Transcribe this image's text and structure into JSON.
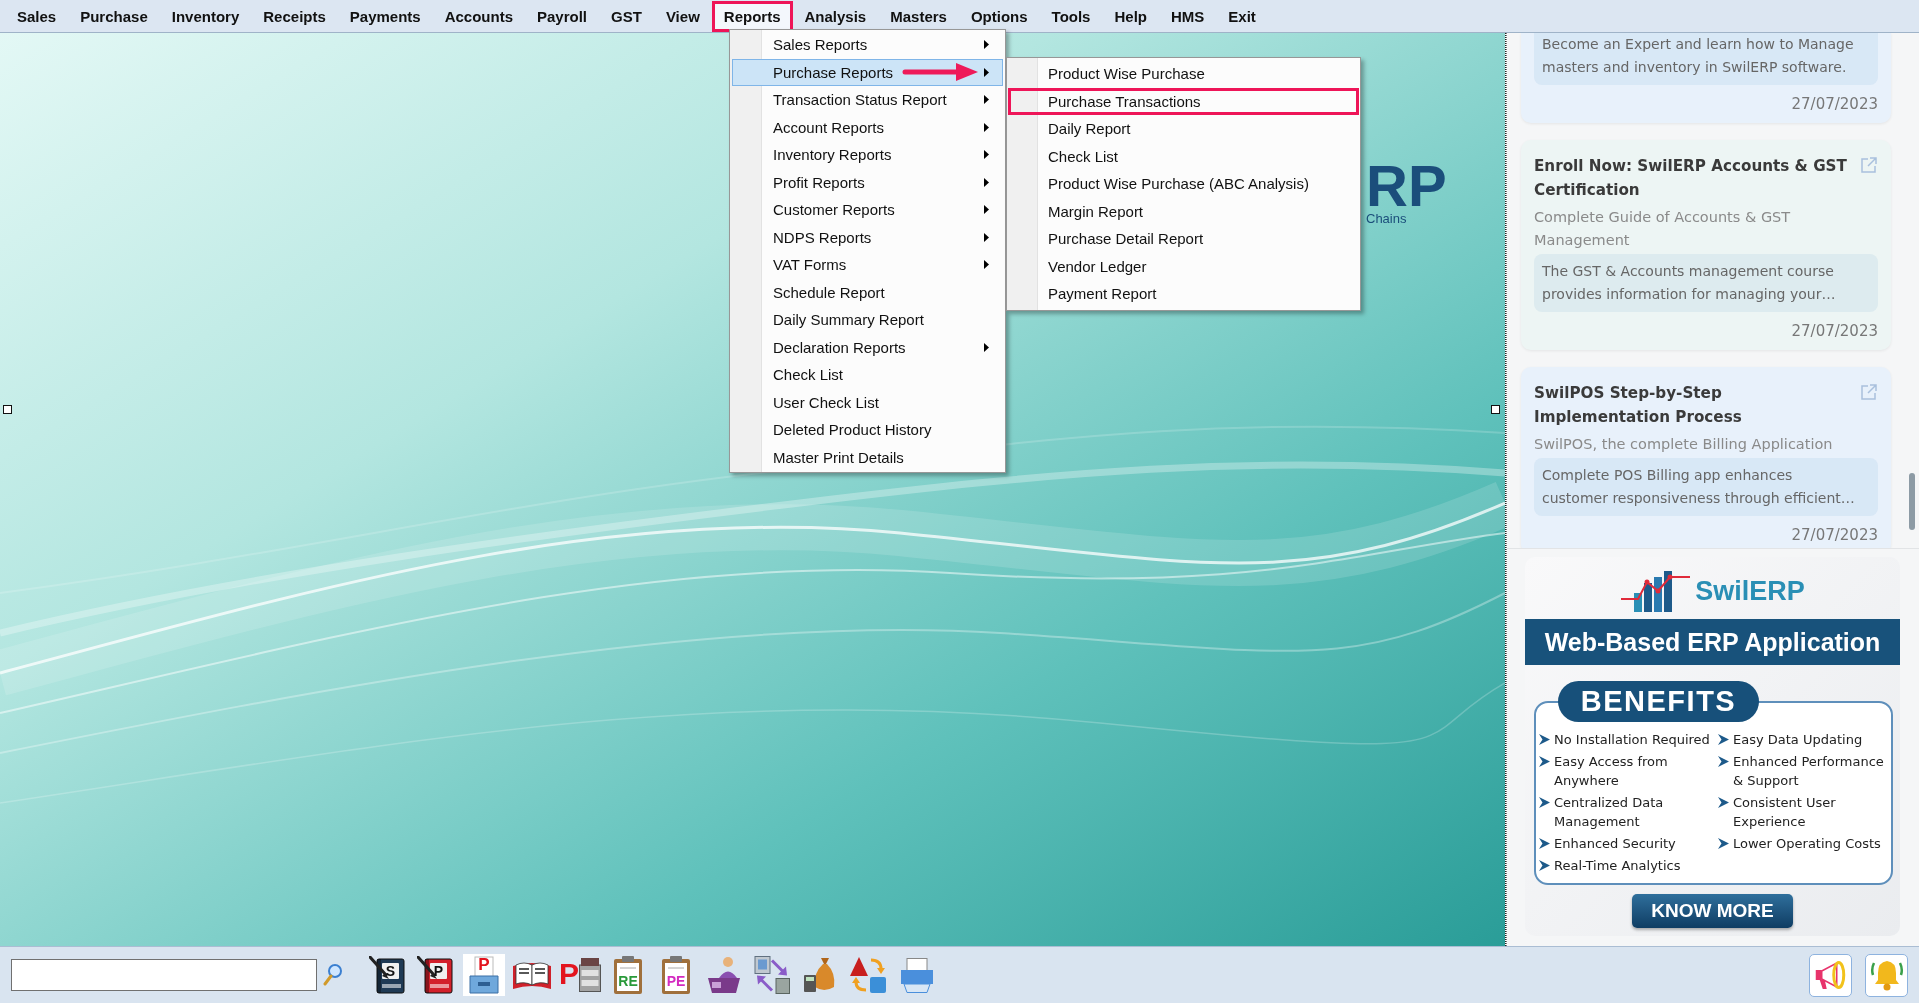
{
  "menu_bar": {
    "items": [
      {
        "label": "Sales",
        "selected": false,
        "annotated": false
      },
      {
        "label": "Purchase",
        "selected": false,
        "annotated": false
      },
      {
        "label": "Inventory",
        "selected": false,
        "annotated": false
      },
      {
        "label": "Receipts",
        "selected": false,
        "annotated": false
      },
      {
        "label": "Payments",
        "selected": false,
        "annotated": false
      },
      {
        "label": "Accounts",
        "selected": false,
        "annotated": false
      },
      {
        "label": "Payroll",
        "selected": false,
        "annotated": false
      },
      {
        "label": "GST",
        "selected": false,
        "annotated": false
      },
      {
        "label": "View",
        "selected": false,
        "annotated": false
      },
      {
        "label": "Reports",
        "selected": true,
        "annotated": true
      },
      {
        "label": "Analysis",
        "selected": false,
        "annotated": false
      },
      {
        "label": "Masters",
        "selected": false,
        "annotated": false
      },
      {
        "label": "Options",
        "selected": false,
        "annotated": false
      },
      {
        "label": "Tools",
        "selected": false,
        "annotated": false
      },
      {
        "label": "Help",
        "selected": false,
        "annotated": false
      },
      {
        "label": "HMS",
        "selected": false,
        "annotated": false
      },
      {
        "label": "Exit",
        "selected": false,
        "annotated": false
      }
    ]
  },
  "reports_menu": {
    "items": [
      {
        "label": "Sales Reports",
        "has_submenu": true,
        "selected": false,
        "pointer": false
      },
      {
        "label": "Purchase Reports",
        "has_submenu": true,
        "selected": true,
        "pointer": true
      },
      {
        "label": "Transaction Status Report",
        "has_submenu": true,
        "selected": false,
        "pointer": false
      },
      {
        "label": "Account Reports",
        "has_submenu": true,
        "selected": false,
        "pointer": false
      },
      {
        "label": "Inventory Reports",
        "has_submenu": true,
        "selected": false,
        "pointer": false
      },
      {
        "label": "Profit Reports",
        "has_submenu": true,
        "selected": false,
        "pointer": false
      },
      {
        "label": "Customer Reports",
        "has_submenu": true,
        "selected": false,
        "pointer": false
      },
      {
        "label": "NDPS Reports",
        "has_submenu": true,
        "selected": false,
        "pointer": false
      },
      {
        "label": "VAT Forms",
        "has_submenu": true,
        "selected": false,
        "pointer": false
      },
      {
        "label": "Schedule Report",
        "has_submenu": false,
        "selected": false,
        "pointer": false
      },
      {
        "label": "Daily Summary Report",
        "has_submenu": false,
        "selected": false,
        "pointer": false
      },
      {
        "label": "Declaration Reports",
        "has_submenu": true,
        "selected": false,
        "pointer": false
      },
      {
        "label": "Check List",
        "has_submenu": false,
        "selected": false,
        "pointer": false
      },
      {
        "label": "User Check List",
        "has_submenu": false,
        "selected": false,
        "pointer": false
      },
      {
        "label": "Deleted Product History",
        "has_submenu": false,
        "selected": false,
        "pointer": false
      },
      {
        "label": "Master Print Details",
        "has_submenu": false,
        "selected": false,
        "pointer": false
      }
    ]
  },
  "purchase_reports_submenu": {
    "items": [
      {
        "label": "Product Wise Purchase",
        "selected": false,
        "annotated": false
      },
      {
        "label": "Purchase Transactions",
        "selected": false,
        "annotated": true
      },
      {
        "label": "Daily Report",
        "selected": false,
        "annotated": false
      },
      {
        "label": "Check List",
        "selected": false,
        "annotated": false
      },
      {
        "label": "Product Wise Purchase (ABC Analysis)",
        "selected": false,
        "annotated": false
      },
      {
        "label": "Margin Report",
        "selected": false,
        "annotated": false
      },
      {
        "label": "Purchase Detail Report",
        "selected": false,
        "annotated": false
      },
      {
        "label": "Vendor Ledger",
        "selected": false,
        "annotated": false
      },
      {
        "label": "Payment Report",
        "selected": false,
        "annotated": false
      }
    ]
  },
  "background_logo": {
    "letters": "RP",
    "tagline": "Chains"
  },
  "news_cards": [
    {
      "color": "#e8f1fb",
      "link_icon": false,
      "description": "Become an Expert and learn how to Manage masters and inventory in SwilERP software.",
      "date": "27/07/2023"
    },
    {
      "color": "#edf5f4",
      "link_icon": true,
      "title": "Enroll Now: SwilERP Accounts & GST Certification",
      "subtitle": "Complete Guide of Accounts & GST Management",
      "description": "The GST & Accounts management course provides information for managing your…",
      "date": "27/07/2023"
    },
    {
      "color": "#e8f1fb",
      "link_icon": true,
      "title": "SwilPOS Step-by-Step Implementation Process",
      "subtitle": "SwilPOS, the complete Billing Application",
      "description": "Complete POS Billing app enhances customer responsiveness through efficient…",
      "date": "27/07/2023"
    }
  ],
  "ad_banner": {
    "logo": "SwilERP",
    "headline": "Web-Based ERP Application",
    "badge": "BENEFITS",
    "benefits": [
      "No Installation Required",
      "Easy Data Updating",
      "Easy Access from Anywhere",
      "Enhanced Performance & Support",
      "Centralized Data Management",
      "Consistent User Experience",
      "Enhanced Security",
      "Lower Operating Costs",
      "Real-Time Analytics"
    ],
    "button": "KNOW MORE"
  },
  "bottom_toolbar": {
    "tools": [
      {
        "kind": "book",
        "letter": "S",
        "color": "#1f3a55"
      },
      {
        "kind": "book",
        "letter": "P",
        "color": "#d3202b"
      },
      {
        "kind": "file-box",
        "letter": "P"
      },
      {
        "kind": "order-book"
      },
      {
        "kind": "letter-machine",
        "letter": "P"
      },
      {
        "kind": "clipboard",
        "letter": "RE",
        "color": "#2a9a3a"
      },
      {
        "kind": "clipboard",
        "letter": "PE",
        "color": "#d42bc0"
      },
      {
        "kind": "cashier"
      },
      {
        "kind": "transfer"
      },
      {
        "kind": "money-bag"
      },
      {
        "kind": "shapes"
      },
      {
        "kind": "printer"
      }
    ],
    "notifications": [
      {
        "kind": "megaphone"
      },
      {
        "kind": "bell"
      }
    ]
  }
}
